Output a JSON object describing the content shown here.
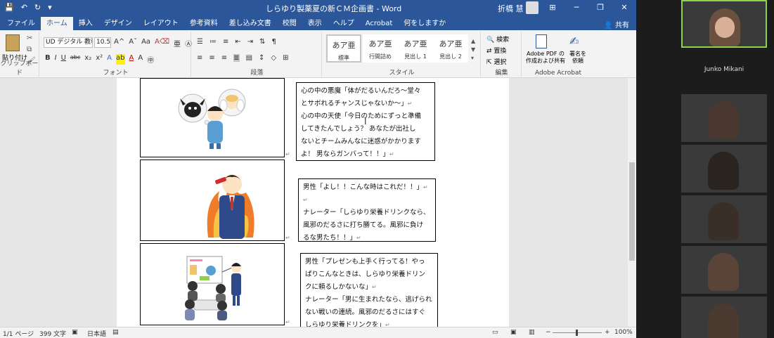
{
  "word": {
    "title": "しらゆり製薬夏の新ＣＭ企画書 - Word",
    "user": "折橋 慧",
    "window_buttons": [
      "⊞",
      "─",
      "❐",
      "✕"
    ],
    "tabs": [
      "ファイル",
      "ホーム",
      "挿入",
      "デザイン",
      "レイアウト",
      "参考資料",
      "差し込み文書",
      "校閲",
      "表示",
      "ヘルプ",
      "Acrobat",
      "何をしますか"
    ],
    "active_tab": "ホーム",
    "share_label": "共有",
    "ribbon": {
      "clipboard": {
        "paste": "貼り付け",
        "label": "クリップボード"
      },
      "font": {
        "name": "UD デジタル 教科",
        "size": "10.5",
        "label": "フォント",
        "buttons": [
          "B",
          "I",
          "U",
          "abc",
          "x₂",
          "x²"
        ],
        "grow": "A^",
        "shrink": "Aˇ",
        "case": "Aa"
      },
      "paragraph": {
        "label": "段落"
      },
      "styles": {
        "label": "スタイル",
        "items": [
          {
            "preview": "あア亜",
            "name": "標準"
          },
          {
            "preview": "あア亜",
            "name": "行間詰め"
          },
          {
            "preview": "あア亜",
            "name": "見出し 1"
          },
          {
            "preview": "あア亜",
            "name": "見出し 2"
          }
        ]
      },
      "editing": {
        "label": "編集",
        "items": [
          "検索",
          "置換",
          "選択"
        ]
      },
      "acrobat": {
        "label": "Adobe Acrobat",
        "create": "Adobe PDF の作成および共有",
        "sign": "署名を依頼"
      }
    },
    "panels": [
      {
        "lines": [
          "心の中の悪魔「体がだるいんだろ～堂々",
          "とサボれるチャンスじゃないか～」",
          "心の中の天使「今日のためにずっと準備",
          "してきたんでしょう？ あなたが出社し",
          "ないとチームみんなに迷惑がかかります",
          "よ！ 男ならガンバって！！」"
        ]
      },
      {
        "lines": [
          "男性「よし！！こんな時はこれだ！！」",
          "",
          "ナレーター「しらゆり栄養ドリンクなら、",
          "風邪のだるさに打ち勝てる。風邪に負け",
          "るな男たち！！」"
        ]
      },
      {
        "lines": [
          "男性「プレゼンも上手く行ってる！やっ",
          "ぱりこんなときは、しらゆり栄養ドリン",
          "クに頼るしかないな」",
          "ナレーター「男に生まれたなら、逃げられ",
          "ない戦いの連続。風邪のだるさにはすぐ",
          "しらゆり栄養ドリンクを」"
        ]
      }
    ],
    "status": {
      "page": "1/1 ページ",
      "words": "399 文字",
      "lang": "日本語",
      "zoom": "100%",
      "zoom_level": 1.0
    }
  },
  "meeting": {
    "participant_name": "Junko Mikani"
  },
  "colors": {
    "word_blue": "#2b579a",
    "active_speaker": "#8ed14a"
  }
}
